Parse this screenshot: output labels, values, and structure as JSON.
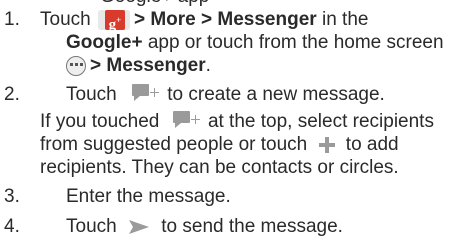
{
  "top_partial": "Google+ app",
  "steps": [
    {
      "number": "1.",
      "touch": "Touch",
      "path1": "> More > Messenger",
      "in_the": "in the",
      "app_name": "Google+",
      "app_rest": "app or touch from the home screen",
      "path2": "> Messenger",
      "period": "."
    },
    {
      "number": "2.",
      "touch": "Touch",
      "rest": "to create a new message."
    },
    {
      "number": "3.",
      "text": "Enter the message."
    },
    {
      "number": "4.",
      "touch": "Touch",
      "rest": "to send the message."
    }
  ],
  "note": {
    "line1_a": "If you touched",
    "line1_b": "at the top, select recipients",
    "line2_a": "from suggested people or touch",
    "line2_b": "to add",
    "line3": "recipients. They can be contacts or circles."
  },
  "icons": {
    "google_plus": "google-plus-icon",
    "apps": "apps-icon",
    "new_message": "new-message-icon",
    "add": "plus-icon",
    "send": "send-arrow-icon"
  },
  "colors": {
    "text": "#2a2a2a",
    "google_plus_red": "#d83a2b",
    "icon_gray": "#9a9a9a"
  }
}
